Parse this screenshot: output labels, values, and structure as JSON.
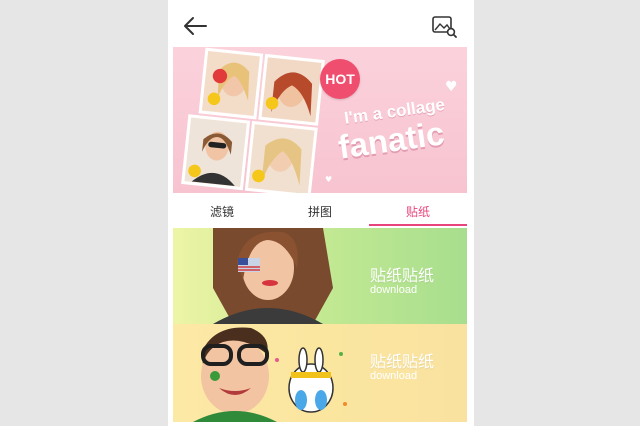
{
  "header": {
    "back_icon": "arrow-left-icon",
    "gallery_icon": "image-search-icon"
  },
  "banner": {
    "badge": "HOT",
    "tagline_line1": "I'm a collage",
    "tagline_line2": "fanatic"
  },
  "tabs": [
    {
      "label": "滤镜",
      "active": false
    },
    {
      "label": "拼图",
      "active": false
    },
    {
      "label": "贴纸",
      "active": true
    }
  ],
  "cards": [
    {
      "title": "贴纸贴纸",
      "subtitle": "download"
    },
    {
      "title": "贴纸贴纸",
      "subtitle": "download"
    }
  ],
  "colors": {
    "accent": "#e8457c",
    "banner_bg": "#f7c3d0",
    "hot_badge": "#f04e6e",
    "card1_bg": "#c6ea93",
    "card2_bg": "#fbe6a0"
  }
}
